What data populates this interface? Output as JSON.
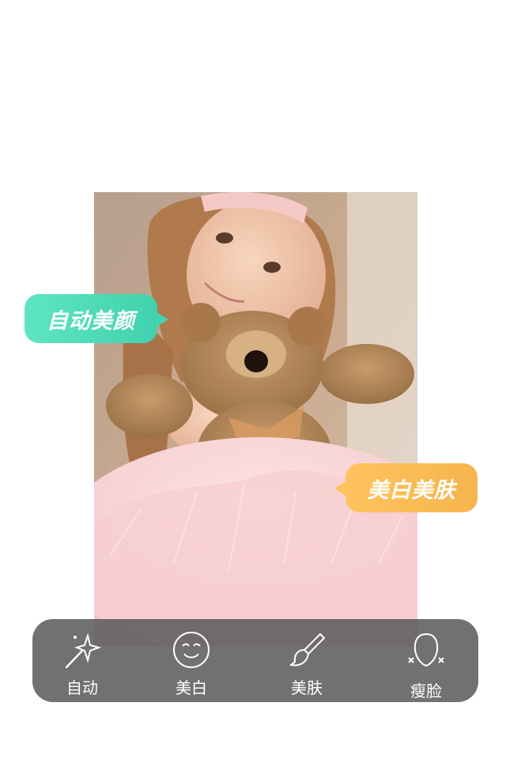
{
  "badges": {
    "auto_beauty": "自动美颜",
    "whitening": "美白美肤"
  },
  "toolbar": {
    "items": [
      {
        "label": "自动",
        "icon": "magic-wand-icon"
      },
      {
        "label": "美白",
        "icon": "smile-face-icon"
      },
      {
        "label": "美肤",
        "icon": "brush-icon"
      },
      {
        "label": "瘦脸",
        "icon": "face-slim-icon"
      }
    ]
  },
  "colors": {
    "green": "#4fdbb8",
    "yellow": "#ffbe55",
    "toolbar_bg": "#5a5a5a"
  }
}
